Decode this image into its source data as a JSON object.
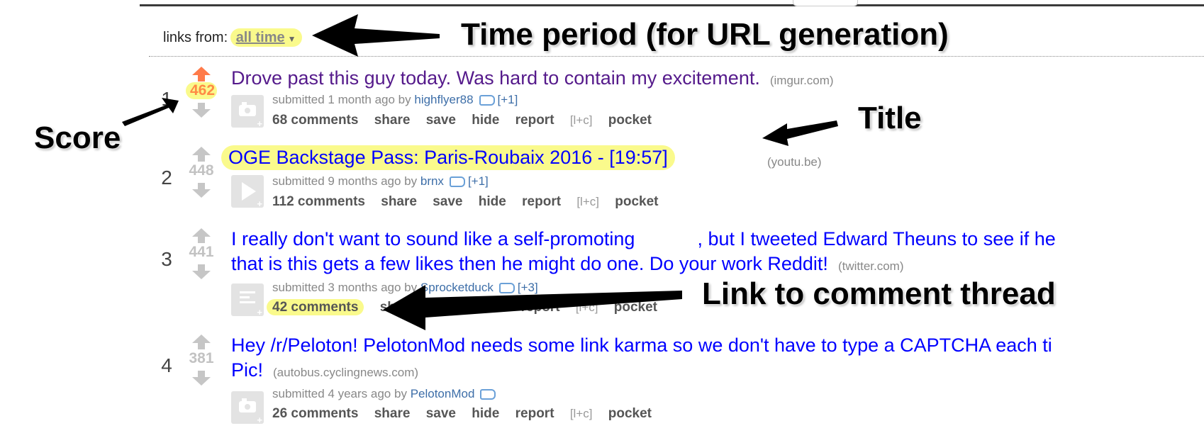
{
  "filter": {
    "label": "links from:",
    "period": "all time"
  },
  "posts": [
    {
      "rank": "1",
      "score": "462",
      "title": "Drove past this guy today. Was hard to contain my excitement.",
      "domain": "(imgur.com)",
      "submitted": "submitted 1 month ago by",
      "author": "highflyer88",
      "plus": "[+1]",
      "comments": "68 comments"
    },
    {
      "rank": "2",
      "score": "448",
      "title": "OGE Backstage Pass: Paris-Roubaix 2016 - [19:57]",
      "domain": "(youtu.be)",
      "submitted": "submitted 9 months ago by",
      "author": "brnx",
      "plus": "[+1]",
      "comments": "112 comments"
    },
    {
      "rank": "3",
      "score": "441",
      "title_part1": "I really don't want to sound like a self-promoting",
      "title_part2": ", but I tweeted Edward Theuns to see if he",
      "title_line2": "that is this gets a few likes then he might do one. Do your work Reddit!",
      "domain": "(twitter.com)",
      "submitted": "submitted 3 months ago by",
      "author": "Sprocketduck",
      "plus": "[+3]",
      "comments": "42 comments"
    },
    {
      "rank": "4",
      "score": "381",
      "title_line1": "Hey /r/Peloton! PelotonMod needs some link karma so we don't have to type a CAPTCHA each ti",
      "title_line2": "Pic!",
      "domain": "(autobus.cyclingnews.com)",
      "submitted": "submitted 4 years ago by",
      "author": "PelotonMod",
      "comments": "26 comments"
    }
  ],
  "actions": {
    "share": "share",
    "save": "save",
    "hide": "hide",
    "report": "report",
    "lc": "[l+c]",
    "pocket": "pocket"
  },
  "annotations": {
    "time_period": "Time period (for URL generation)",
    "score": "Score",
    "title": "Title",
    "comment_link": "Link to comment thread"
  }
}
